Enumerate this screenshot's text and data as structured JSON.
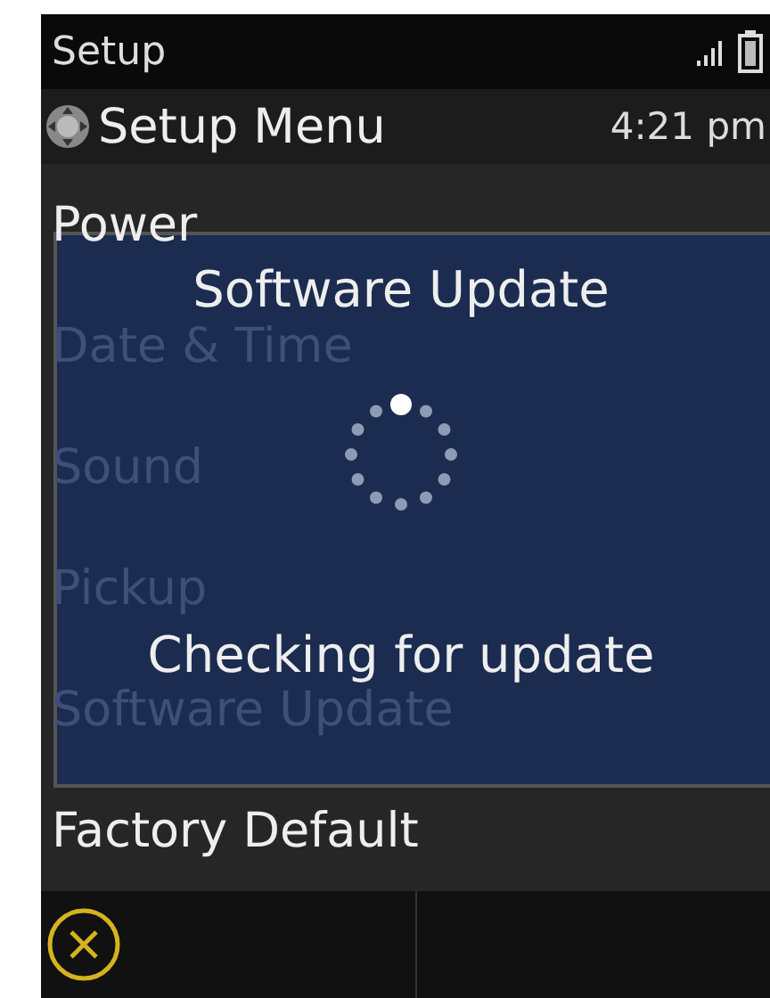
{
  "status_bar": {
    "title": "Setup"
  },
  "header": {
    "title": "Setup Menu",
    "time": "4:21 pm"
  },
  "menu_items": [
    {
      "label": "Power",
      "dimmed": false
    },
    {
      "label": "Date & Time",
      "dimmed": true
    },
    {
      "label": "Sound",
      "dimmed": true
    },
    {
      "label": "Pickup",
      "dimmed": true
    },
    {
      "label": "Software Update",
      "dimmed": true
    },
    {
      "label": "Factory Default",
      "dimmed": false
    }
  ],
  "dialog": {
    "title": "Software Update",
    "message": "Checking for update"
  }
}
